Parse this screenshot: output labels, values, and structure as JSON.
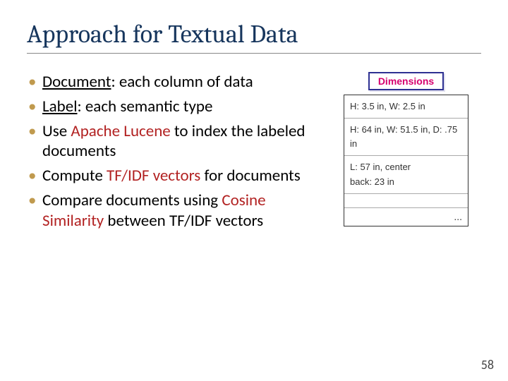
{
  "title": "Approach for Textual Data",
  "bullets": {
    "b1": {
      "t1": "Document",
      "t2": ": each column of data"
    },
    "b2": {
      "t1": "Label",
      "t2": ": each semantic type"
    },
    "b3": {
      "t1": "Use ",
      "t2": "Apache Lucene",
      "t3": " to index the labeled documents"
    },
    "b4": {
      "t1": "Compute ",
      "t2": "TF/IDF vectors",
      "t3": " for documents"
    },
    "b5": {
      "t1": "Compare documents using ",
      "t2": "Cosine Similarity",
      "t3": " between TF/IDF vectors"
    }
  },
  "diagram": {
    "header": "Dimensions",
    "rows": {
      "r1": "H: 3.5 in, W: 2.5 in",
      "r2": "H: 64 in, W: 51.5 in, D: .75 in",
      "r3a": "L: 57 in,  center",
      "r3b": "back: 23 in",
      "r4": "",
      "r5": "..."
    }
  },
  "page_number": "58"
}
